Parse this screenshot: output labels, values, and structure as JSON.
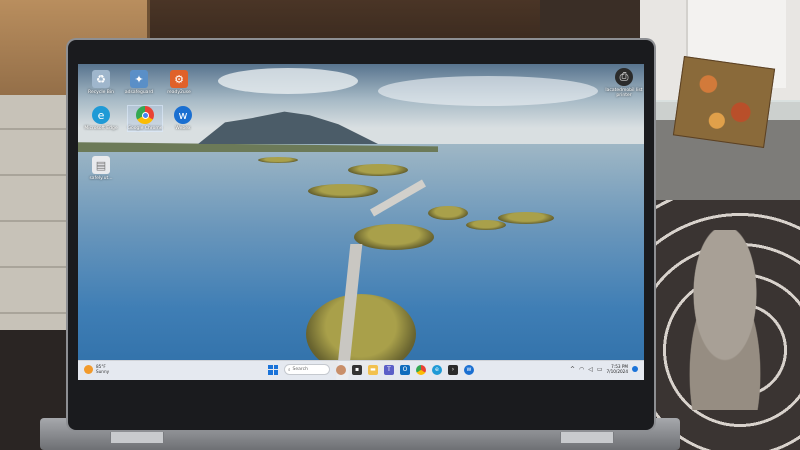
{
  "desktop": {
    "icons": [
      {
        "label": "Recycle Bin",
        "icon": "recycle-bin-icon",
        "color": "#9fb6cc"
      },
      {
        "label": "adsafeguard",
        "icon": "app-icon",
        "color": "#5a8fc7"
      },
      {
        "label": "ready2use",
        "icon": "app-icon",
        "color": "#e0612a"
      },
      {
        "label": "Microsoft Edge",
        "icon": "edge-icon",
        "color": "#1f9ad6"
      },
      {
        "label": "Google Chrome",
        "icon": "chrome-icon",
        "color": "#e94235"
      },
      {
        "label": "Webex",
        "icon": "webex-icon",
        "color": "#1a6fd1"
      },
      {
        "label": "safely.ut...",
        "icon": "file-icon",
        "color": "#e8eaed"
      },
      {
        "label": "lacatedmobil list printer",
        "icon": "printer-icon",
        "color": "#2b2b2b"
      }
    ]
  },
  "taskbar": {
    "weather_temp": "85°F",
    "weather_cond": "Sunny",
    "search_placeholder": "Search",
    "time": "7:53 PM",
    "date": "7/10/2024",
    "apps": [
      {
        "icon": "person-app-icon",
        "color": "#c98f6a"
      },
      {
        "icon": "task-view-icon",
        "color": "#333333"
      },
      {
        "icon": "file-explorer-icon",
        "color": "#f2c14e"
      },
      {
        "icon": "teams-icon",
        "color": "#5b5fc7"
      },
      {
        "icon": "outlook-icon",
        "color": "#0f6cbd"
      },
      {
        "icon": "chrome-icon",
        "color": "#e94235"
      },
      {
        "icon": "edge-icon",
        "color": "#1f9ad6"
      },
      {
        "icon": "terminal-icon",
        "color": "#2b2b2b"
      },
      {
        "icon": "webex-icon",
        "color": "#1a6fd1"
      }
    ]
  },
  "accent": "#1a73d9"
}
